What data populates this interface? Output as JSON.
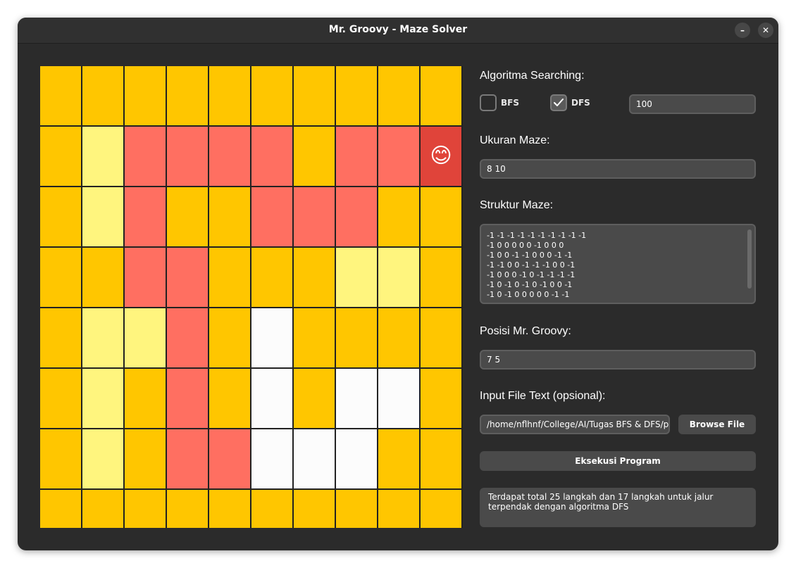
{
  "window": {
    "title": "Mr. Groovy - Maze Solver",
    "minimize_icon": "minimize-icon",
    "minimize_glyph": "–",
    "close_icon": "close-icon",
    "close_glyph": "✕"
  },
  "colors": {
    "unvisited": "#ffc600",
    "visited": "#fff57e",
    "path": "#ff6f61",
    "current": "#e0443a",
    "empty": "#fcfcfc"
  },
  "maze": {
    "rows": 8,
    "cols": 10,
    "player_icon": "smiley-face-icon",
    "player_glyph": "😊",
    "grid": [
      [
        "U",
        "U",
        "U",
        "U",
        "U",
        "U",
        "U",
        "U",
        "U",
        "U"
      ],
      [
        "U",
        "V",
        "P",
        "P",
        "P",
        "P",
        "U",
        "P",
        "P",
        "C"
      ],
      [
        "U",
        "V",
        "P",
        "U",
        "U",
        "P",
        "P",
        "P",
        "U",
        "U"
      ],
      [
        "U",
        "U",
        "P",
        "P",
        "U",
        "U",
        "U",
        "V",
        "V",
        "U"
      ],
      [
        "U",
        "V",
        "V",
        "P",
        "U",
        "E",
        "U",
        "U",
        "U",
        "U"
      ],
      [
        "U",
        "V",
        "U",
        "P",
        "U",
        "E",
        "U",
        "E",
        "E",
        "U"
      ],
      [
        "U",
        "V",
        "U",
        "P",
        "P",
        "E",
        "E",
        "E",
        "U",
        "U"
      ],
      [
        "U",
        "U",
        "U",
        "U",
        "U",
        "U",
        "U",
        "U",
        "U",
        "U"
      ]
    ]
  },
  "algorithm": {
    "label": "Algoritma Searching:",
    "bfs_label": "BFS",
    "bfs_checked": false,
    "dfs_label": "DFS",
    "dfs_checked": true,
    "checkmark_icon": "checkmark-icon",
    "delay_value": "100"
  },
  "size": {
    "label": "Ukuran Maze:",
    "value": "8 10"
  },
  "structure": {
    "label": "Struktur Maze:",
    "lines": [
      "-1 -1 -1 -1 -1 -1 -1 -1 -1 -1",
      "-1 0 0 0 0 0 -1 0 0 0",
      "-1 0 0 -1 -1 0 0 0 -1 -1",
      "-1 -1 0 0 -1 -1 -1 0 0 -1",
      "-1 0 0 0 -1 0 -1 -1 -1 -1",
      "-1 0 -1 0 -1 0 -1 0 0 -1",
      "-1 0 -1 0 0 0 0 0 -1 -1"
    ]
  },
  "position": {
    "label": "Posisi Mr. Groovy:",
    "value": "7 5"
  },
  "file": {
    "label": "Input File Text (opsional):",
    "path": "/home/nflhnf/College/AI/Tugas BFS & DFS/pub",
    "browse_label": "Browse File"
  },
  "execute": {
    "label": "Eksekusi Program"
  },
  "output": {
    "text": "Terdapat total 25 langkah dan 17 langkah untuk jalur terpendak dengan algoritma DFS"
  }
}
